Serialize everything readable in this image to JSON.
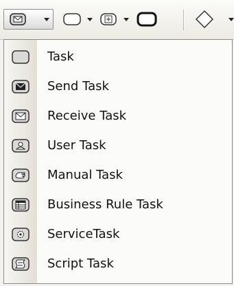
{
  "toolbar": {
    "buttons": [
      {
        "icon": "task-envelope-icon",
        "has_dropdown": true,
        "active": true
      },
      {
        "icon": "rounded-rect-icon",
        "has_dropdown": true
      },
      {
        "icon": "subprocess-icon",
        "has_dropdown": true
      },
      {
        "icon": "thick-rect-icon",
        "has_dropdown": false
      },
      {
        "icon": "gateway-diamond-icon",
        "has_dropdown": true
      }
    ]
  },
  "menu": {
    "items": [
      {
        "label": "Task",
        "icon": "task-icon"
      },
      {
        "label": "Send Task",
        "icon": "send-task-icon"
      },
      {
        "label": "Receive Task",
        "icon": "receive-task-icon"
      },
      {
        "label": "User Task",
        "icon": "user-task-icon"
      },
      {
        "label": "Manual Task",
        "icon": "manual-task-icon"
      },
      {
        "label": "Business Rule Task",
        "icon": "business-rule-task-icon"
      },
      {
        "label": "ServiceTask",
        "icon": "service-task-icon"
      },
      {
        "label": "Script Task",
        "icon": "script-task-icon"
      }
    ]
  }
}
